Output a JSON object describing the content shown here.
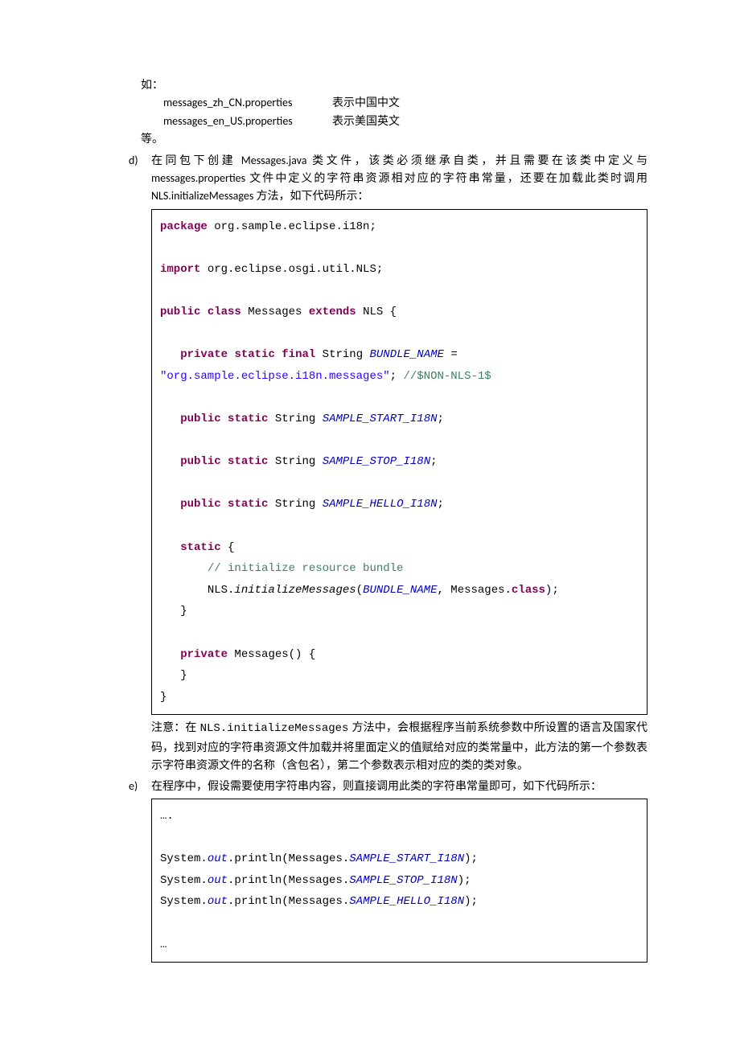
{
  "intro": {
    "line1": "如：",
    "file1_name": "messages_zh_CN.properties",
    "file1_desc": "表示中国中文",
    "file2_name": "messages_en_US.properties",
    "file2_desc": "表示美国英文",
    "line_end": "等。"
  },
  "item_d": {
    "marker": "d)",
    "text": "在同包下创建 Messages.java 类文件，该类必须继承自类，并且需要在该类中定义与 messages.properties 文件中定义的字符串资源相对应的字符串常量，还要在加载此类时调用 NLS.initializeMessages 方法，如下代码所示：",
    "code": {
      "kw_package": "package",
      "pkg": " org.sample.eclipse.i18n;",
      "kw_import": "import",
      "imp": " org.eclipse.osgi.util.NLS;",
      "kw_public": "public",
      "kw_class": "class",
      "cls_name": " Messages ",
      "kw_extends": "extends",
      "ext_name": " NLS {",
      "kw_private": "private",
      "kw_static": "static",
      "kw_final": "final",
      "type_string": " String ",
      "bundle_name": "BUNDLE_NAME",
      "eq": " = ",
      "bundle_val": "\"org.sample.eclipse.i18n.messages\"",
      "semi": "; ",
      "cmt_nonls": "//$NON-NLS-1$",
      "field_start": "SAMPLE_START_I18N",
      "field_stop": "SAMPLE_STOP_I18N",
      "field_hello": "SAMPLE_HELLO_I18N",
      "static_open": " {",
      "cmt_init": "// initialize resource bundle",
      "nls_call_a": "NLS.",
      "nls_call_m": "initializeMessages",
      "nls_call_b": "(",
      "nls_call_c": ", Messages.",
      "kw_class2": "class",
      "nls_call_d": ");",
      "brace_close": "}",
      "ctor_a": " Messages() {",
      "brace_close2": "}",
      "brace_close3": "}"
    },
    "note_prefix": "注意：在 ",
    "note_mono": "NLS.initializeMessages",
    "note_rest": " 方法中，会根据程序当前系统参数中所设置的语言及国家代码，找到对应的字符串资源文件加载并将里面定义的值赋给对应的类常量中，此方法的第一个参数表示字符串资源文件的名称（含包名），第二个参数表示相对应的类的类对象。"
  },
  "item_e": {
    "marker": "e)",
    "text": "在程序中，假设需要使用字符串内容，则直接调用此类的字符串常量即可，如下代码所示：",
    "code": {
      "dots": "….",
      "sys": "System.",
      "out": "out",
      "println_a": ".println(Messages.",
      "println_b": ");",
      "f1": "SAMPLE_START_I18N",
      "f2": "SAMPLE_STOP_I18N",
      "f3": "SAMPLE_HELLO_I18N",
      "dots2": "…"
    }
  }
}
